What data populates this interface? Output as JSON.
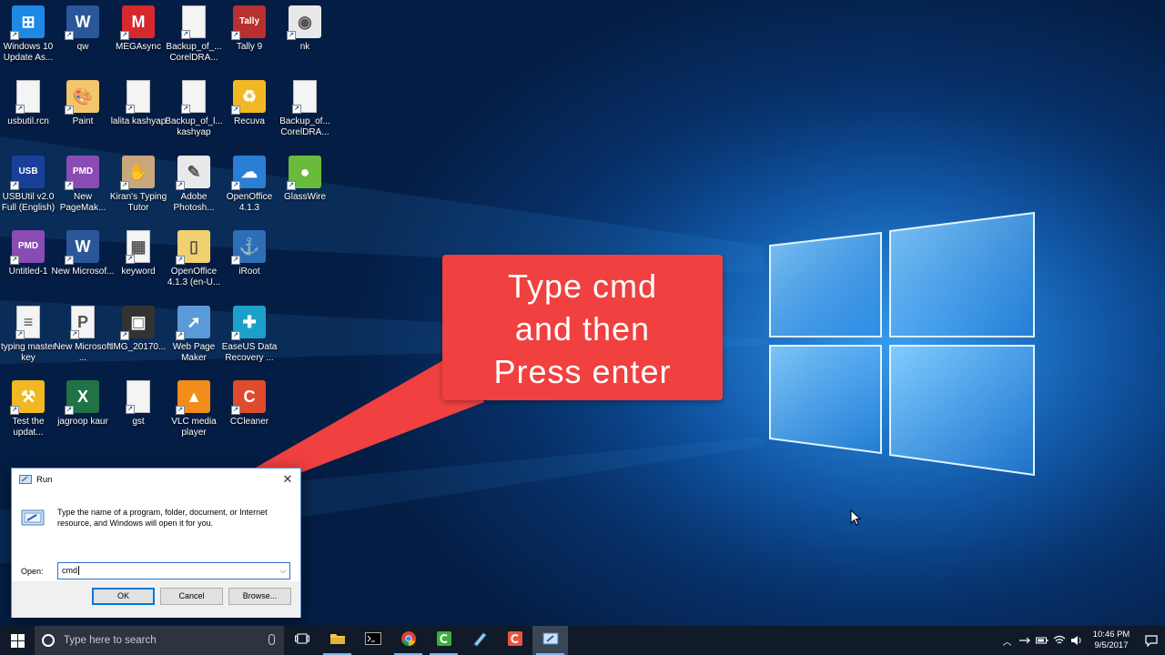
{
  "desktop_icons": [
    {
      "label": "Windows 10 Update As...",
      "icon": "windows-update-icon",
      "color": "#1e88e5",
      "glyph": "⊞"
    },
    {
      "label": "qw",
      "icon": "word-doc-icon",
      "color": "#2b579a",
      "glyph": "W"
    },
    {
      "label": "MEGAsync",
      "icon": "mega-icon",
      "color": "#d9272e",
      "glyph": "M"
    },
    {
      "label": "Backup_of_... CorelDRA...",
      "icon": "blank-file-icon",
      "color": "#f4f4f4",
      "glyph": ""
    },
    {
      "label": "Tally 9",
      "icon": "tally-icon",
      "color": "#b8302f",
      "glyph": "Tally"
    },
    {
      "label": "nk",
      "icon": "chrome-icon",
      "color": "#e8e8e8",
      "glyph": "◉"
    },
    {
      "label": "usbutil.rcn",
      "icon": "blank-file-icon",
      "color": "#f4f4f4",
      "glyph": ""
    },
    {
      "label": "Paint",
      "icon": "paint-palette-icon",
      "color": "#f2c66d",
      "glyph": "🎨"
    },
    {
      "label": "lalita kashyap",
      "icon": "blank-file-icon",
      "color": "#f4f4f4",
      "glyph": ""
    },
    {
      "label": "Backup_of_l... kashyap",
      "icon": "blank-file-icon",
      "color": "#f4f4f4",
      "glyph": ""
    },
    {
      "label": "Recuva",
      "icon": "recuva-icon",
      "color": "#f2b824",
      "glyph": "♻"
    },
    {
      "label": "Backup_of... CorelDRA...",
      "icon": "blank-file-icon",
      "color": "#f4f4f4",
      "glyph": ""
    },
    {
      "label": "USBUtil v2.0 Full (English)",
      "icon": "usbutil-icon",
      "color": "#1a3f9a",
      "glyph": "USB"
    },
    {
      "label": "New PageMak...",
      "icon": "pagemaker-icon",
      "color": "#8a4bb5",
      "glyph": "PMD"
    },
    {
      "label": "Kiran's Typing Tutor",
      "icon": "typing-tutor-icon",
      "color": "#c9a77c",
      "glyph": "✋"
    },
    {
      "label": "Adobe Photosh...",
      "icon": "photoshop-icon",
      "color": "#e9e9e9",
      "glyph": "✎"
    },
    {
      "label": "OpenOffice 4.1.3",
      "icon": "openoffice-icon",
      "color": "#2a7fd4",
      "glyph": "☁"
    },
    {
      "label": "GlassWire",
      "icon": "glasswire-icon",
      "color": "#6aba3c",
      "glyph": "●"
    },
    {
      "label": "Untitled-1",
      "icon": "pagemaker-icon",
      "color": "#8a4bb5",
      "glyph": "PMD"
    },
    {
      "label": "New Microsof...",
      "icon": "word-doc-icon",
      "color": "#2b579a",
      "glyph": "W"
    },
    {
      "label": "keyword",
      "icon": "spreadsheet-file-icon",
      "color": "#f4f4f4",
      "glyph": "▦"
    },
    {
      "label": "OpenOffice 4.1.3 (en-U...",
      "icon": "folder-icon",
      "color": "#f0d070",
      "glyph": "▯"
    },
    {
      "label": "iRoot",
      "icon": "iroot-anchor-icon",
      "color": "#2e6db8",
      "glyph": "⚓"
    },
    {
      "label": "",
      "icon": "",
      "color": "",
      "glyph": ""
    },
    {
      "label": "typing master key",
      "icon": "text-file-icon",
      "color": "#f4f4f4",
      "glyph": "≡"
    },
    {
      "label": "New Microsoft ...",
      "icon": "powerpoint-icon",
      "color": "#f4f4f4",
      "glyph": "P"
    },
    {
      "label": "IMG_20170...",
      "icon": "image-file-icon",
      "color": "#333333",
      "glyph": "▣"
    },
    {
      "label": "Web Page Maker",
      "icon": "web-page-maker-icon",
      "color": "#5a9ad8",
      "glyph": "➚"
    },
    {
      "label": "EaseUS Data Recovery ...",
      "icon": "easeus-icon",
      "color": "#1ba1c9",
      "glyph": "✚"
    },
    {
      "label": "",
      "icon": "",
      "color": "",
      "glyph": ""
    },
    {
      "label": "Test the updat...",
      "icon": "drill-icon",
      "color": "#f2b824",
      "glyph": "⚒"
    },
    {
      "label": "jagroop kaur",
      "icon": "excel-icon",
      "color": "#217346",
      "glyph": "X"
    },
    {
      "label": "gst",
      "icon": "blank-file-icon",
      "color": "#f4f4f4",
      "glyph": ""
    },
    {
      "label": "VLC media player",
      "icon": "vlc-icon",
      "color": "#f28c1a",
      "glyph": "▲"
    },
    {
      "label": "CCleaner",
      "icon": "ccleaner-icon",
      "color": "#e04a2e",
      "glyph": "C"
    }
  ],
  "callout": {
    "lines": [
      "Type cmd",
      "and then",
      "Press enter"
    ],
    "color": "#f04040"
  },
  "run_dialog": {
    "title": "Run",
    "description": "Type the name of a program, folder, document, or Internet resource, and Windows will open it for you.",
    "open_label": "Open:",
    "open_value": "cmd",
    "ok_label": "OK",
    "cancel_label": "Cancel",
    "browse_label": "Browse..."
  },
  "taskbar": {
    "search_placeholder": "Type here to search",
    "apps": [
      {
        "icon": "task-view-icon",
        "state": "normal"
      },
      {
        "icon": "file-explorer-icon",
        "state": "open"
      },
      {
        "icon": "command-prompt-icon",
        "state": "normal"
      },
      {
        "icon": "chrome-icon",
        "state": "open"
      },
      {
        "icon": "camtasia-icon",
        "state": "open"
      },
      {
        "icon": "paint-tool-icon",
        "state": "normal"
      },
      {
        "icon": "camtasia-recorder-icon",
        "state": "normal"
      },
      {
        "icon": "run-app-icon",
        "state": "active"
      }
    ],
    "clock_time": "10:46 PM",
    "clock_date": "9/5/2017"
  }
}
